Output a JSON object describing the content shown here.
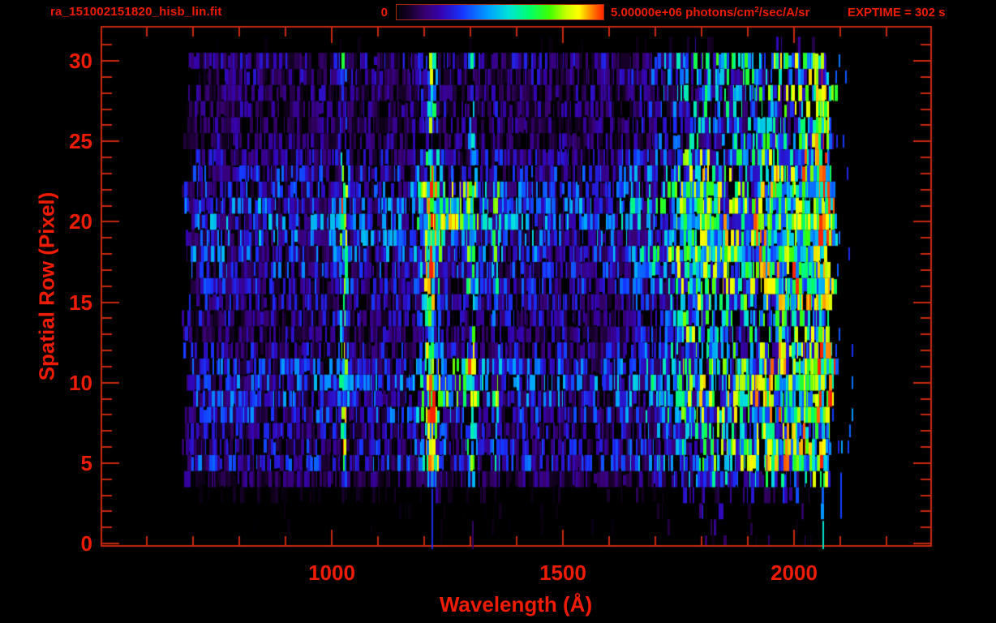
{
  "window": {
    "background": "#000000"
  },
  "colors": {
    "text_red": "#ee1c04",
    "axis_red": "#c9290f",
    "background": "#000000"
  },
  "header": {
    "filename": "ra_151002151820_hisb_lin.fit",
    "colorbar": {
      "min_label": "0",
      "max_label_prefix": "5.00000e+06 photons/cm",
      "max_label_sup": "2",
      "max_label_suffix": "/sec/A/sr"
    },
    "exptime_label": "EXPTIME = 302 s"
  },
  "chart_data": {
    "type": "heatmap",
    "title": "ra_151002151820_hisb_lin.fit",
    "xlabel": "Wavelength (Å)",
    "ylabel": "Spatial Row (Pixel)",
    "xlim": [
      502,
      2296
    ],
    "ylim": [
      -0.15,
      32.1
    ],
    "grid": false,
    "x_axis": {
      "major_ticks": [
        1000,
        1500,
        2000
      ],
      "tick_labels": [
        "1000",
        "1500",
        "2000"
      ],
      "minor_tick_step": 100
    },
    "y_axis": {
      "major_ticks": [
        0,
        5,
        10,
        15,
        20,
        25,
        30
      ],
      "tick_labels": [
        "0",
        "5",
        "10",
        "15",
        "20",
        "25",
        "30"
      ],
      "minor_tick_step": 1
    },
    "colorbar": {
      "min_value": 0,
      "max_value": 5000000,
      "min_label": "0",
      "max_label": "5.00000e+06 photons/cm2/sec/A/sr",
      "stops": [
        [
          0.0,
          "#000000"
        ],
        [
          0.07,
          "#1a0030"
        ],
        [
          0.14,
          "#380072"
        ],
        [
          0.22,
          "#3304b4"
        ],
        [
          0.32,
          "#1536ff"
        ],
        [
          0.44,
          "#009cff"
        ],
        [
          0.54,
          "#00e2da"
        ],
        [
          0.64,
          "#00ff6e"
        ],
        [
          0.74,
          "#3fff00"
        ],
        [
          0.82,
          "#c8ff00"
        ],
        [
          0.88,
          "#ffff00"
        ],
        [
          0.94,
          "#ff8a00"
        ],
        [
          1.0,
          "#ff2200"
        ]
      ]
    },
    "exposure_time_s": 302,
    "wavelength_data_range": [
      674,
      2085
    ],
    "spatial_rows": 32,
    "background_level": 0.24,
    "row_activity": [
      0.02,
      0.05,
      0.09,
      0.14,
      0.38,
      0.78,
      0.66,
      0.6,
      0.82,
      0.88,
      0.92,
      0.82,
      0.62,
      0.52,
      0.56,
      0.62,
      0.72,
      0.78,
      0.92,
      0.97,
      1.0,
      0.95,
      0.86,
      0.72,
      0.6,
      0.46,
      0.42,
      0.44,
      0.46,
      0.5,
      0.55,
      0.05
    ],
    "row_lya_strength": [
      0.1,
      0.12,
      0.15,
      0.2,
      0.5,
      1.15,
      1.05,
      0.75,
      1.2,
      1.25,
      1.2,
      1.1,
      0.8,
      0.7,
      0.75,
      0.8,
      0.95,
      1.0,
      1.15,
      1.2,
      1.15,
      1.1,
      1.05,
      0.9,
      0.8,
      0.45,
      0.4,
      0.4,
      0.42,
      0.45,
      0.5,
      0.05
    ],
    "emission_lines": [
      {
        "wavelength": 1026,
        "amplitude": 0.4,
        "sigma": 7
      },
      {
        "wavelength": 1216,
        "amplitude": 0.62,
        "sigma": 9,
        "wing_amplitude": 0.25,
        "wing_sigma": 22
      },
      {
        "wavelength": 1304,
        "amplitude": 0.42,
        "sigma": 8
      },
      {
        "wavelength": 1356,
        "amplitude": 0.15,
        "sigma": 7
      }
    ],
    "continuum": {
      "onset": 1600,
      "mid": 1900,
      "mid_level": 0.3,
      "end": 2050,
      "end_level": 0.55
    },
    "bump_1800": {
      "center": 1795,
      "sigma": 45,
      "amp_core": 0.3,
      "rows_core": [
        16,
        22
      ],
      "amp_mid": 0.18,
      "rows_mid": [
        13,
        24
      ],
      "amp_other": 0.07
    },
    "bridge_feature": {
      "center": 1268,
      "sigma": 58,
      "amp_strong": 0.28,
      "rows_strong": [
        20,
        22
      ],
      "amp_weak": 0.15,
      "rows_weak": [
        9,
        11
      ]
    },
    "bright_edge": {
      "wavelength_range": [
        2050,
        2095
      ]
    },
    "stray_lines": [
      {
        "wavelength": 1216,
        "rows": [
          0,
          3
        ],
        "level": 0.3
      },
      {
        "wavelength": 1304,
        "rows": [
          0,
          1
        ],
        "level": 0.13
      },
      {
        "wavelength": 2062,
        "rows": [
          0,
          1
        ],
        "level": 0.55
      },
      {
        "wavelength": 2100,
        "rows": [
          2,
          4
        ],
        "level": 0.33
      }
    ]
  }
}
